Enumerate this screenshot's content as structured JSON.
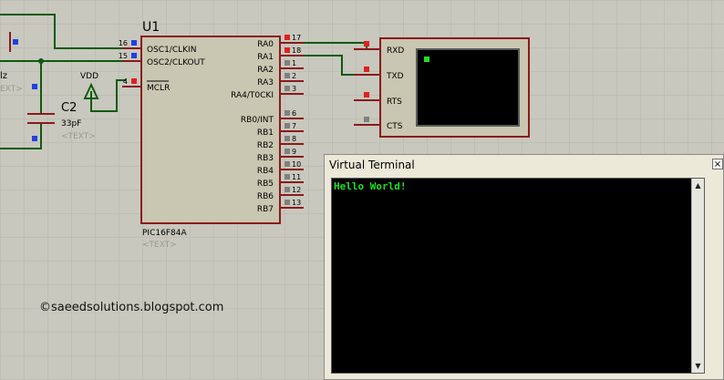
{
  "colors": {
    "background": "#c8c8be",
    "grid": "#b5b5ab",
    "wire": "#0f5a0f",
    "component": "#8b1a1a",
    "chip_fill": "#c9c6b1",
    "pin_red": "#e02020",
    "pin_blue": "#2040e0",
    "pin_gray": "#808080",
    "terminal_text": "#22e022"
  },
  "left_fragments": {
    "hz_text": "lz",
    "text_placeholder": "EXT>"
  },
  "capacitor": {
    "ref": "C2",
    "value": "33pF",
    "text_placeholder": "<TEXT>"
  },
  "power": {
    "label": "VDD"
  },
  "mcu": {
    "ref": "U1",
    "part": "PIC16F84A",
    "text_placeholder": "<TEXT>",
    "left_pins": [
      {
        "num": "16",
        "name": "OSC1/CLKIN",
        "overline": false
      },
      {
        "num": "15",
        "name": "OSC2/CLKOUT",
        "overline": false
      },
      {
        "num": "4",
        "name": "MCLR",
        "overline": true
      }
    ],
    "right_pins": [
      {
        "num": "17",
        "name": "RA0",
        "state": "red"
      },
      {
        "num": "18",
        "name": "RA1",
        "state": "red"
      },
      {
        "num": "1",
        "name": "RA2",
        "state": "gray"
      },
      {
        "num": "2",
        "name": "RA3",
        "state": "gray"
      },
      {
        "num": "3",
        "name": "RA4/T0CKI",
        "state": "gray"
      },
      {
        "num": "6",
        "name": "RB0/INT",
        "state": "gray"
      },
      {
        "num": "7",
        "name": "RB1",
        "state": "gray"
      },
      {
        "num": "8",
        "name": "RB2",
        "state": "gray"
      },
      {
        "num": "9",
        "name": "RB3",
        "state": "gray"
      },
      {
        "num": "10",
        "name": "RB4",
        "state": "gray"
      },
      {
        "num": "11",
        "name": "RB5",
        "state": "gray"
      },
      {
        "num": "12",
        "name": "RB6",
        "state": "gray"
      },
      {
        "num": "13",
        "name": "RB7",
        "state": "gray"
      }
    ]
  },
  "vt_block": {
    "pins": [
      {
        "name": "RXD",
        "state": "red"
      },
      {
        "name": "TXD",
        "state": "red"
      },
      {
        "name": "RTS",
        "state": "red"
      },
      {
        "name": "CTS",
        "state": "gray"
      }
    ]
  },
  "terminal": {
    "title": "Virtual Terminal",
    "close_glyph": "×",
    "output": "Hello World!"
  },
  "credit": "©saeedsolutions.blogspot.com"
}
